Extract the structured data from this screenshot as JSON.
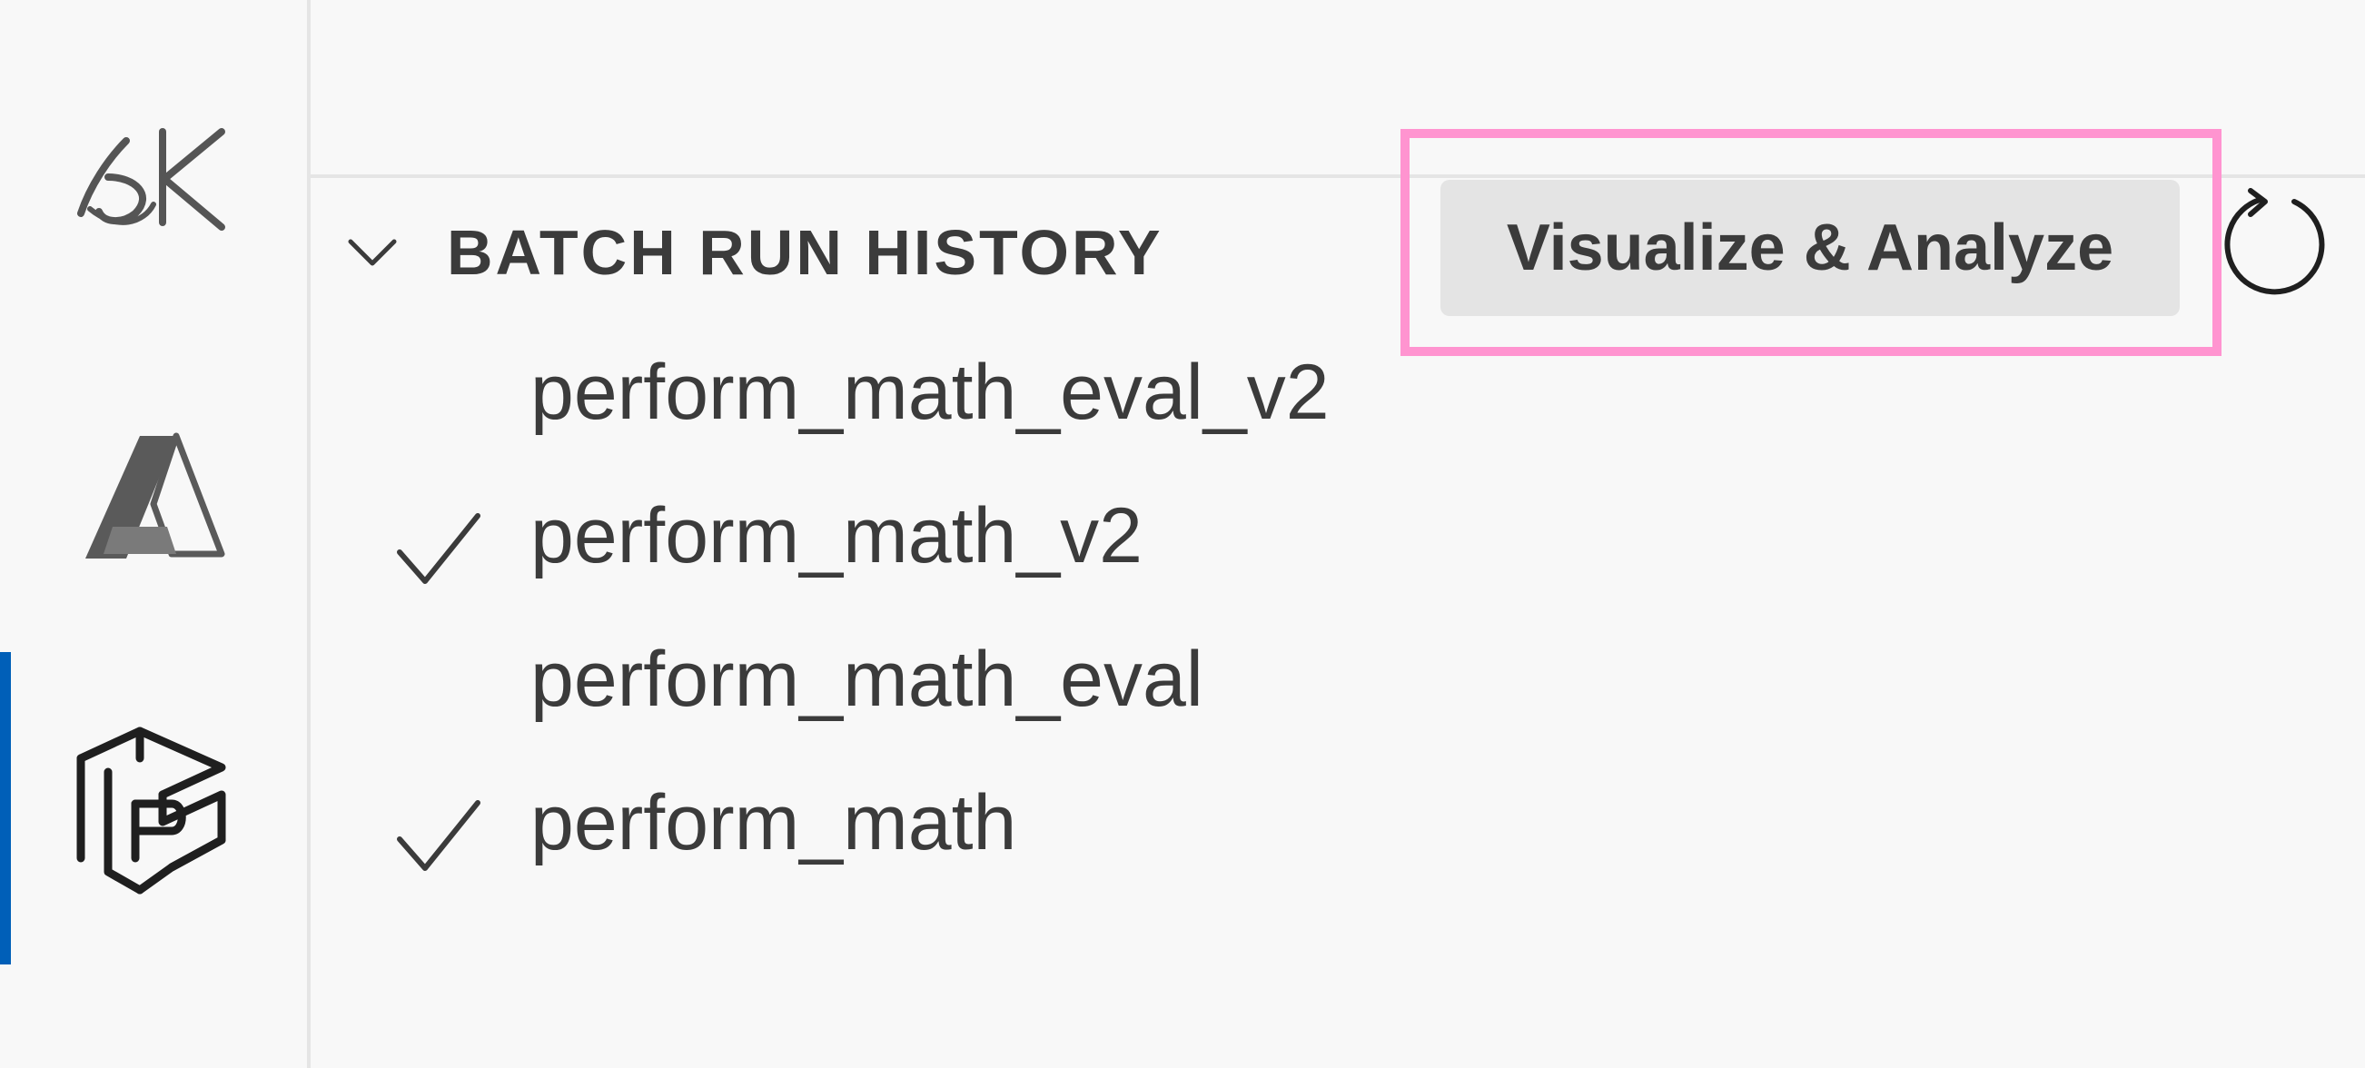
{
  "activity_bar": {
    "items": [
      {
        "icon": "semantic-kernel-icon",
        "active": false
      },
      {
        "icon": "azure-icon",
        "active": false
      },
      {
        "icon": "prompt-flow-icon",
        "active": true
      }
    ]
  },
  "side_panel": {
    "section": {
      "title": "BATCH RUN HISTORY",
      "expanded": true,
      "actions": {
        "visualize_label": "Visualize & Analyze",
        "refresh_icon": "refresh-icon"
      }
    },
    "runs": [
      {
        "label": "perform_math_eval_v2",
        "checked": false
      },
      {
        "label": "perform_math_v2",
        "checked": true
      },
      {
        "label": "perform_math_eval",
        "checked": false
      },
      {
        "label": "perform_math",
        "checked": true
      }
    ]
  },
  "colors": {
    "background": "#f8f8f8",
    "text": "#3b3b3b",
    "active_indicator": "#005fb8",
    "highlight": "#ff94d0",
    "button_bg": "#e4e4e4"
  }
}
